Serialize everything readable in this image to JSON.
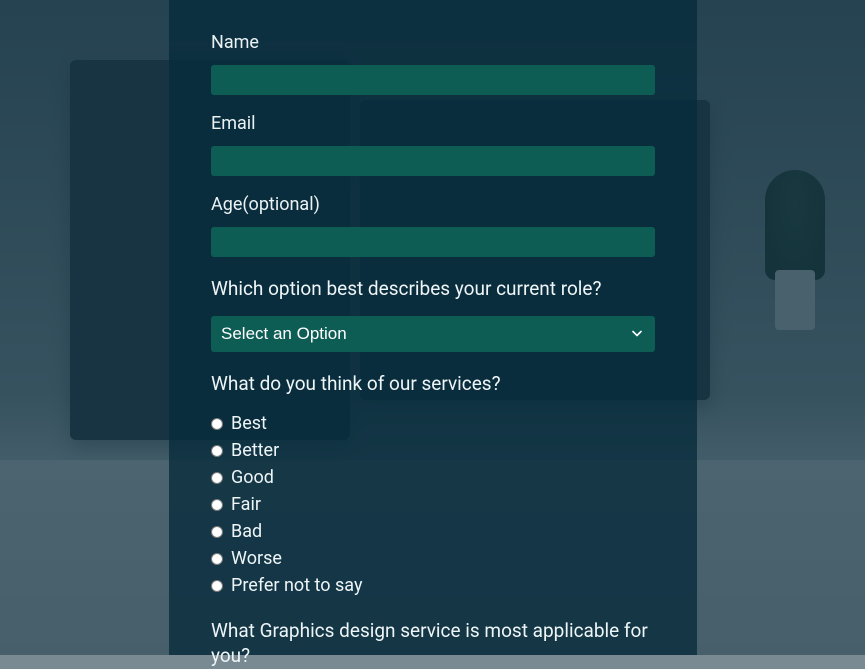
{
  "fields": {
    "name": {
      "label": "Name",
      "value": ""
    },
    "email": {
      "label": "Email",
      "value": ""
    },
    "age": {
      "label": "Age(optional)",
      "value": ""
    }
  },
  "roleQuestion": {
    "label": "Which option best describes your current role?",
    "selected": "Select an Option"
  },
  "servicesQuestion": {
    "label": "What do you think of our services?",
    "options": [
      "Best",
      "Better",
      "Good",
      "Fair",
      "Bad",
      "Worse",
      "Prefer not to say"
    ]
  },
  "graphicsQuestion": {
    "label": "What Graphics design service is most applicable for you?"
  }
}
